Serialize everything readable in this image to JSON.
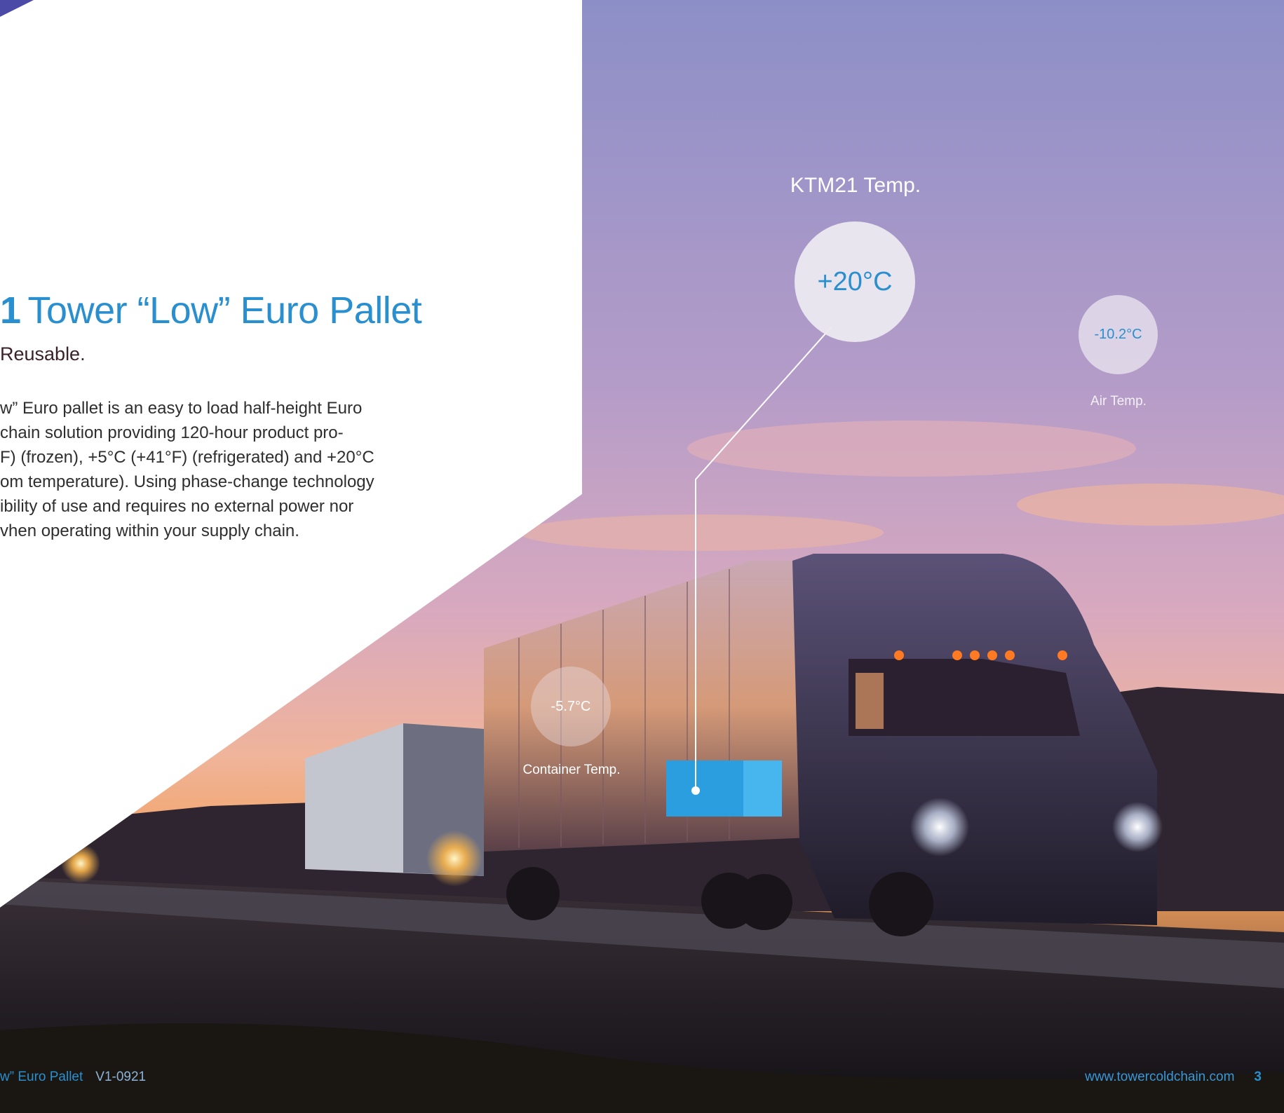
{
  "panel": {
    "title_number": "1",
    "title": "Tower “Low” Euro Pallet",
    "subtitle": "Reusable.",
    "body_lines": [
      "w” Euro pallet is an easy to load half-height Euro",
      "chain solution providing 120-hour product pro-",
      "F) (frozen), +5°C (+41°F) (refrigerated) and +20°C",
      "om temperature). Using phase-change technology",
      "ibility of use and requires no external power nor",
      "vhen operating within your supply chain."
    ]
  },
  "readings": {
    "ktm": {
      "label": "KTM21 Temp.",
      "value": "+20°C"
    },
    "air": {
      "label": "Air Temp.",
      "value": "-10.2°C"
    },
    "container": {
      "label": "Container Temp.",
      "value": "-5.7°C"
    }
  },
  "footer": {
    "product": "w” Euro Pallet",
    "version": "V1-0921",
    "url": "www.towercoldchain.com",
    "page": "3"
  },
  "colors": {
    "accent": "#2a8fcf",
    "sky_top": "#8c8fc7",
    "sunset": "#f0a060"
  }
}
